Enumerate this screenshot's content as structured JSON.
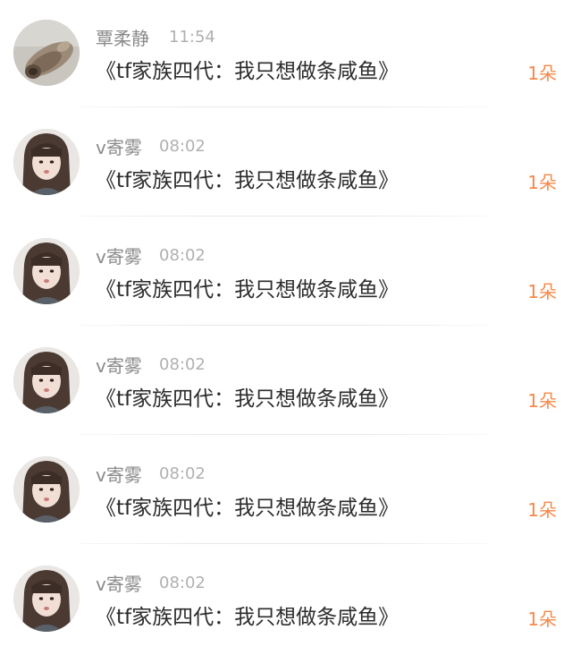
{
  "items": [
    {
      "name": "覃柔静",
      "time": "11:54",
      "message": "《tf家族四代：我只想做条咸鱼》",
      "count": "1朵",
      "avatar": "shell-photo-avatar"
    },
    {
      "name": "v寄雾",
      "time": "08:02",
      "message": "《tf家族四代：我只想做条咸鱼》",
      "count": "1朵",
      "avatar": "girl-photo-avatar"
    },
    {
      "name": "v寄雾",
      "time": "08:02",
      "message": "《tf家族四代：我只想做条咸鱼》",
      "count": "1朵",
      "avatar": "girl-photo-avatar"
    },
    {
      "name": "v寄雾",
      "time": "08:02",
      "message": "《tf家族四代：我只想做条咸鱼》",
      "count": "1朵",
      "avatar": "girl-photo-avatar"
    },
    {
      "name": "v寄雾",
      "time": "08:02",
      "message": "《tf家族四代：我只想做条咸鱼》",
      "count": "1朵",
      "avatar": "girl-photo-avatar"
    },
    {
      "name": "v寄雾",
      "time": "08:02",
      "message": "《tf家族四代：我只想做条咸鱼》",
      "count": "1朵",
      "avatar": "girl-photo-avatar"
    }
  ],
  "colors": {
    "name": "#8a8a8a",
    "time": "#b0b0b0",
    "message": "#2b2b2b",
    "count": "#f5894a"
  }
}
